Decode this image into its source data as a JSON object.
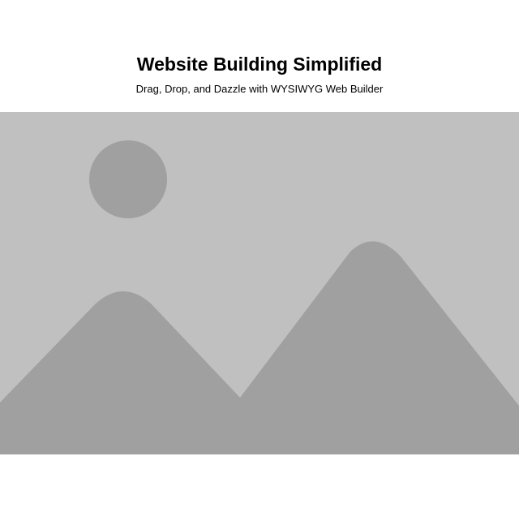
{
  "hero": {
    "title": "Website Building Simplified",
    "subtitle": "Drag, Drop, and Dazzle with WYSIWYG Web Builder"
  },
  "image": {
    "icon": "image-placeholder-icon",
    "background_color": "#c0c0c0",
    "shape_color": "#a0a0a0"
  }
}
